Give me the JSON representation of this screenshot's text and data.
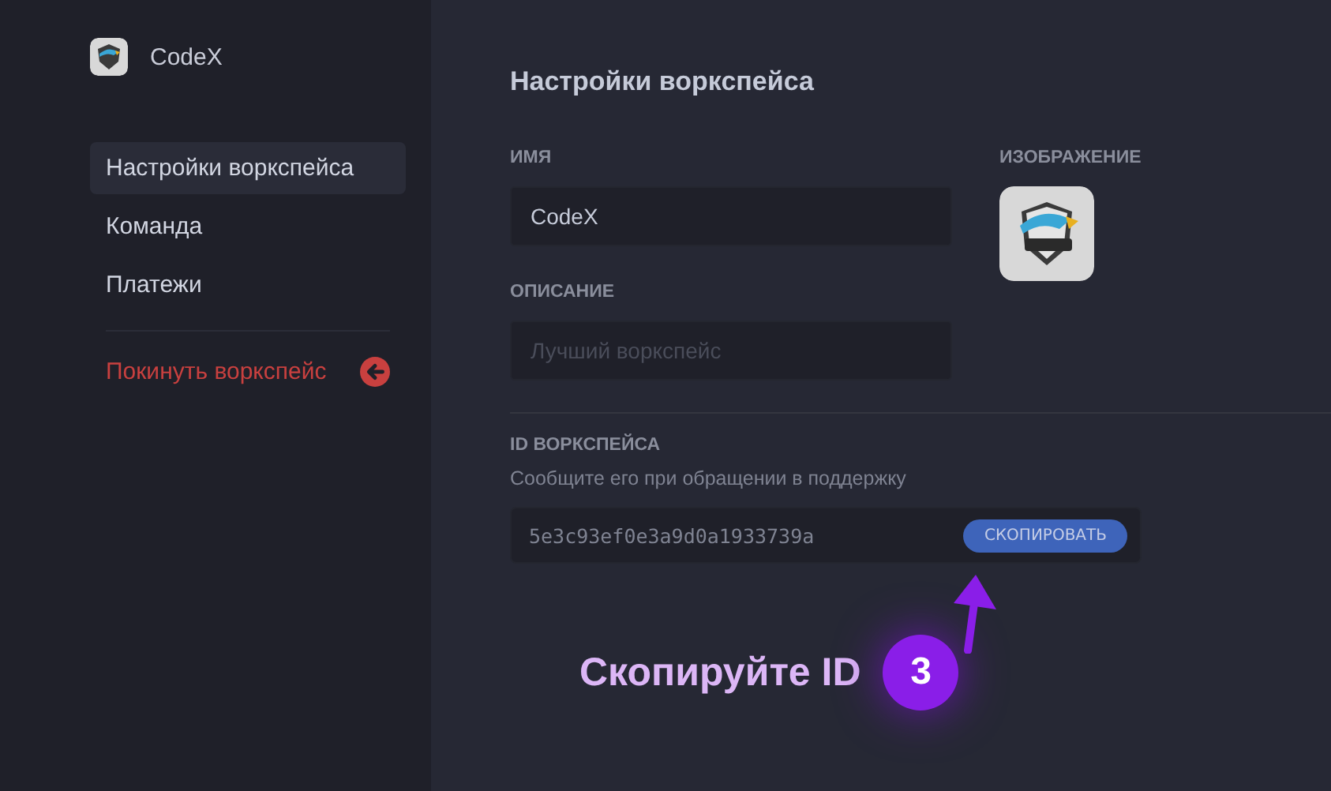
{
  "workspace": {
    "name": "CodeX"
  },
  "sidebar": {
    "items": [
      {
        "label": "Настройки воркспейса",
        "selected": true
      },
      {
        "label": "Команда",
        "selected": false
      },
      {
        "label": "Платежи",
        "selected": false
      }
    ],
    "leave": {
      "label": "Покинуть воркспейс"
    }
  },
  "settings": {
    "title": "Настройки воркспейса",
    "name_field": {
      "label": "ИМЯ",
      "value": "CodeX"
    },
    "description_field": {
      "label": "ОПИСАНИЕ",
      "placeholder": "Лучший воркспейс"
    },
    "image": {
      "label": "ИЗОБРАЖЕНИЕ"
    },
    "id_section": {
      "label": "ID ВОРКСПЕЙСА",
      "hint": "Сообщите его при обращении в поддержку",
      "value": "5e3c93ef0e3a9d0a1933739a",
      "button": "СКОПИРОВАТЬ"
    }
  },
  "callout": {
    "text": "Скопируйте ID",
    "step": "3"
  }
}
